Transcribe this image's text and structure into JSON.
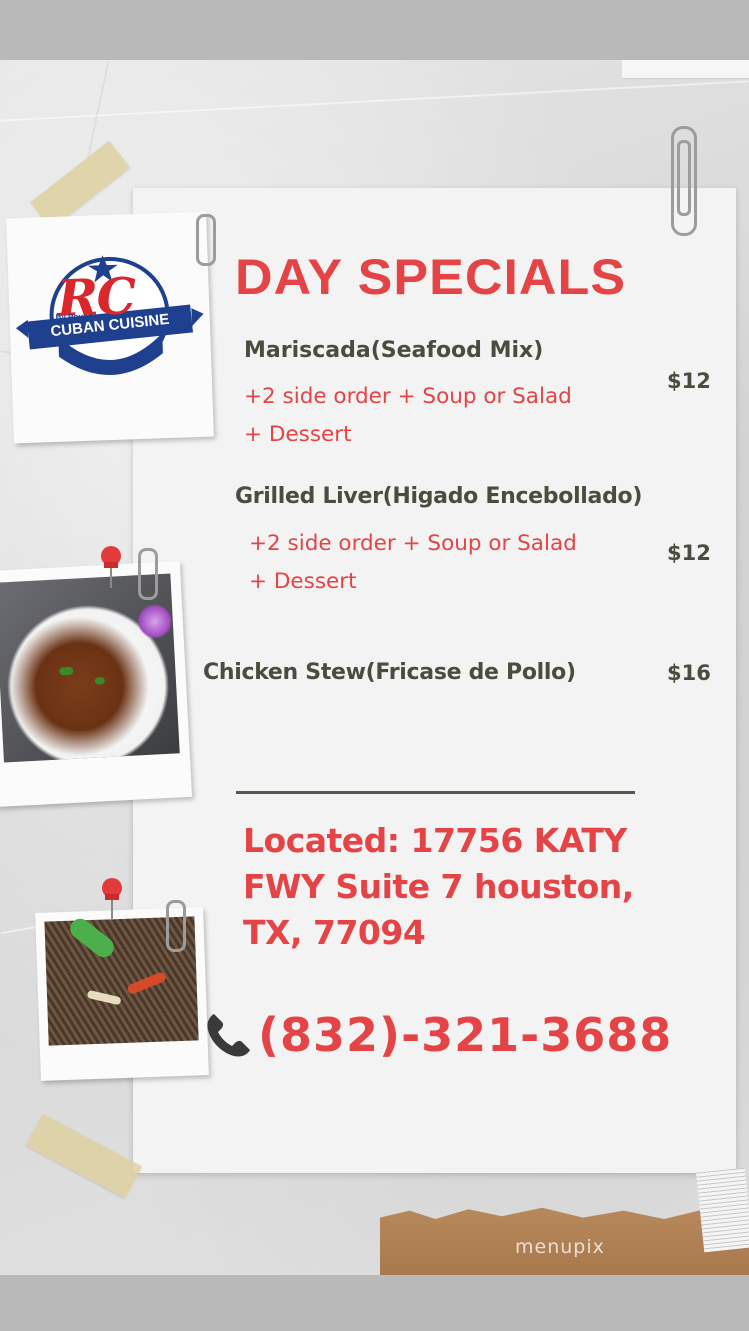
{
  "logo": {
    "monogram": "RC",
    "tagline": "By Pound",
    "name": "CUBAN CUISINE"
  },
  "title": "DAY SPECIALS",
  "items": [
    {
      "name": "Mariscada(Seafood Mix)",
      "desc_line1": "+2 side order + Soup or Salad",
      "desc_line2": "+ Dessert",
      "price": "$12"
    },
    {
      "name": "Grilled Liver(Higado Encebollado)",
      "desc_line1": "+2 side order + Soup or Salad",
      "desc_line2": "+ Dessert",
      "price": "$12"
    },
    {
      "name": "Chicken Stew(Fricase de Pollo)",
      "price": "$16"
    }
  ],
  "location": {
    "text": "Located: 17756 KATY FWY Suite 7 houston, TX, 77094"
  },
  "phone": {
    "number": "(832)-321-3688",
    "icon": "telephone-icon"
  },
  "watermark": "menupix",
  "colors": {
    "accent_red": "#e54446",
    "dark_olive": "#4a4c40",
    "logo_blue": "#1f3f8f",
    "paper": "#f3f3f3"
  }
}
